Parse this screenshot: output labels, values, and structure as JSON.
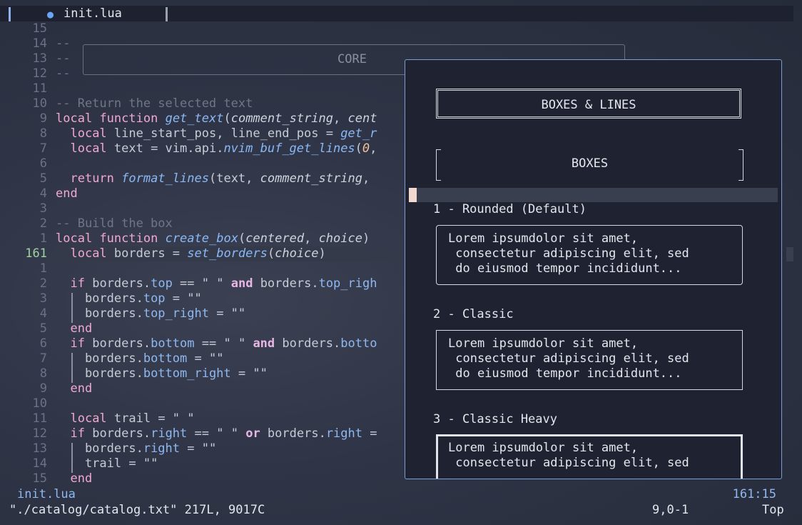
{
  "tab": {
    "title": "init.lua"
  },
  "core_label": "CORE",
  "lines": [
    {
      "n": "15",
      "code": ""
    },
    {
      "n": "14",
      "code": "--"
    },
    {
      "n": "13",
      "code": "--"
    },
    {
      "n": "12",
      "code": "--"
    },
    {
      "n": "11",
      "code": ""
    },
    {
      "n": "10",
      "code": "-- Return the selected text"
    },
    {
      "n": "9",
      "code": "local function get_text(comment_string, cent"
    },
    {
      "n": "8",
      "code": "  local line_start_pos, line_end_pos = get_r"
    },
    {
      "n": "7",
      "code": "  local text = vim.api.nvim_buf_get_lines(0,"
    },
    {
      "n": "6",
      "code": ""
    },
    {
      "n": "5",
      "code": "  return format_lines(text, comment_string,"
    },
    {
      "n": "4",
      "code": "end"
    },
    {
      "n": "3",
      "code": ""
    },
    {
      "n": "2",
      "code": "-- Build the box"
    },
    {
      "n": "1",
      "code": "local function create_box(centered, choice)"
    },
    {
      "n": "161",
      "code": "  local borders = set_borders(choice)"
    },
    {
      "n": "1",
      "code": ""
    },
    {
      "n": "2",
      "code": "  if borders.top == \" \" and borders.top_righ"
    },
    {
      "n": "3",
      "code": "    borders.top = \"\""
    },
    {
      "n": "4",
      "code": "    borders.top_right = \"\""
    },
    {
      "n": "5",
      "code": "  end"
    },
    {
      "n": "6",
      "code": "  if borders.bottom == \" \" and borders.botto"
    },
    {
      "n": "7",
      "code": "    borders.bottom = \"\""
    },
    {
      "n": "8",
      "code": "    borders.bottom_right = \"\""
    },
    {
      "n": "9",
      "code": "  end"
    },
    {
      "n": "10",
      "code": ""
    },
    {
      "n": "11",
      "code": "  local trail = \" \""
    },
    {
      "n": "12",
      "code": "  if borders.right == \" \" or borders.right ="
    },
    {
      "n": "13",
      "code": "    borders.right = \"\""
    },
    {
      "n": "14",
      "code": "    trail = \"\""
    },
    {
      "n": "15",
      "code": "  end"
    }
  ],
  "popup": {
    "title": "BOXES & LINES",
    "section": "BOXES",
    "items": [
      {
        "heading": "1 - Rounded (Default)",
        "sample": "Lorem ipsumdolor sit amet,\n consectetur adipiscing elit, sed\n do eiusmod tempor incididunt..."
      },
      {
        "heading": "2 - Classic",
        "sample": "Lorem ipsumdolor sit amet,\n consectetur adipiscing elit, sed\n do eiusmod tempor incididunt..."
      },
      {
        "heading": "3 - Classic Heavy",
        "sample": "Lorem ipsumdolor sit amet,\n consectetur adipiscing elit, sed"
      }
    ]
  },
  "statusline": {
    "file": "init.lua",
    "position": "161:15"
  },
  "cmdline": {
    "message": "\"./catalog/catalog.txt\" 217L, 9017C",
    "ruler": "9,0-1",
    "scroll": "Top"
  }
}
